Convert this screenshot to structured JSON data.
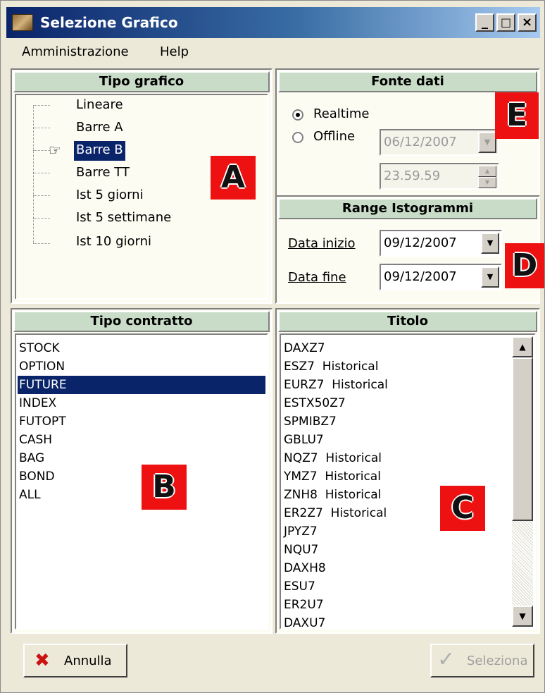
{
  "window": {
    "title": "Selezione Grafico",
    "controls": {
      "minimize": "_",
      "maximize": "□",
      "close": "×"
    }
  },
  "menu": {
    "items": [
      {
        "label": "Amministrazione"
      },
      {
        "label": "Help"
      }
    ]
  },
  "tipo_grafico": {
    "header": "Tipo grafico",
    "items": [
      "Lineare",
      "Barre A",
      "Barre B",
      "Barre TT",
      "Ist 5 giorni",
      "Ist 5 settimane",
      "Ist 10 giorni"
    ],
    "selected": "Barre B",
    "selected_icon": "pointing-hand-icon"
  },
  "fonte_dati": {
    "header": "Fonte dati",
    "realtime_label": "Realtime",
    "offline_label": "Offline",
    "selected": "Realtime",
    "offline_date": "06/12/2007",
    "offline_time": "23.59.59"
  },
  "range_istogrammi": {
    "header": "Range Istogrammi",
    "data_inizio_label": "Data inizio",
    "data_inizio_value": "09/12/2007",
    "data_fine_label": "Data fine",
    "data_fine_value": "09/12/2007"
  },
  "tipo_contratto": {
    "header": "Tipo contratto",
    "items": [
      "STOCK",
      "OPTION",
      "FUTURE",
      "INDEX",
      "FUTOPT",
      "CASH",
      "BAG",
      "BOND",
      "ALL"
    ],
    "selected": "FUTURE"
  },
  "titolo": {
    "header": "Titolo",
    "items": [
      "DAXZ7",
      "ESZ7  Historical",
      "EURZ7  Historical",
      "ESTX50Z7",
      "SPMIBZ7",
      "GBLU7",
      "NQZ7  Historical",
      "YMZ7  Historical",
      "ZNH8  Historical",
      "ER2Z7  Historical",
      "JPYZ7",
      "NQU7",
      "DAXH8",
      "ESU7",
      "ER2U7",
      "DAXU7"
    ]
  },
  "annotations": {
    "a": "A",
    "b": "B",
    "c": "C",
    "d": "D",
    "e": "E"
  },
  "buttons": {
    "annulla": "Annulla",
    "seleziona": "Seleziona"
  },
  "colors": {
    "selection": "#0a246a",
    "panel_header": "#c8dcc8",
    "annotation": "#ee1111"
  }
}
